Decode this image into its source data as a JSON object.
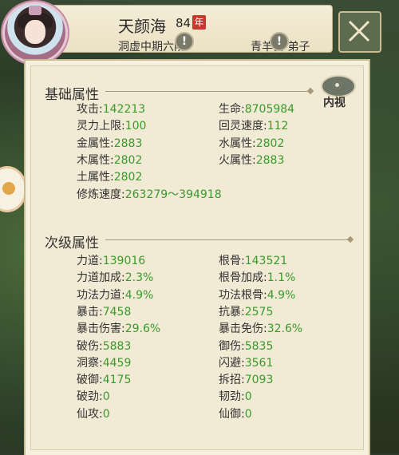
{
  "header": {
    "name": "天颜海",
    "level": "84",
    "level_badge": "年",
    "realm": "洞虚中期六阶",
    "sect": "青羊宫 弟子",
    "warn_icon_char": "!"
  },
  "inner_view": {
    "label": "内视"
  },
  "basic": {
    "title": "基础属性",
    "rows": [
      {
        "label": "攻击",
        "value": "142213"
      },
      {
        "label": "生命",
        "value": "8705984"
      },
      {
        "label": "灵力上限",
        "value": "100"
      },
      {
        "label": "回灵速度",
        "value": "112"
      },
      {
        "label": "金属性",
        "value": "2883"
      },
      {
        "label": "水属性",
        "value": "2802"
      },
      {
        "label": "木属性",
        "value": "2802"
      },
      {
        "label": "火属性",
        "value": "2883"
      },
      {
        "label": "土属性",
        "value": "2802"
      },
      {
        "label": "修炼速度",
        "value": "263279～394918"
      }
    ]
  },
  "secondary": {
    "title": "次级属性",
    "rows": [
      {
        "label": "力道",
        "value": "139016"
      },
      {
        "label": "根骨",
        "value": "143521"
      },
      {
        "label": "力道加成",
        "value": "2.3%"
      },
      {
        "label": "根骨加成",
        "value": "1.1%"
      },
      {
        "label": "功法力道",
        "value": "4.9%"
      },
      {
        "label": "功法根骨",
        "value": "4.9%"
      },
      {
        "label": "暴击",
        "value": "7458"
      },
      {
        "label": "抗暴",
        "value": "2575"
      },
      {
        "label": "暴击伤害",
        "value": "29.6%"
      },
      {
        "label": "暴击免伤",
        "value": "32.6%"
      },
      {
        "label": "破伤",
        "value": "5883"
      },
      {
        "label": "御伤",
        "value": "5835"
      },
      {
        "label": "洞察",
        "value": "4459"
      },
      {
        "label": "闪避",
        "value": "3561"
      },
      {
        "label": "破御",
        "value": "4175"
      },
      {
        "label": "拆招",
        "value": "7093"
      },
      {
        "label": "破劲",
        "value": "0"
      },
      {
        "label": "韧劲",
        "value": "0"
      },
      {
        "label": "仙攻",
        "value": "0"
      },
      {
        "label": "仙御",
        "value": "0"
      }
    ]
  },
  "separator": ":",
  "colors": {
    "value_green": "#3a9a2c",
    "badge_red": "#c23a2e"
  }
}
